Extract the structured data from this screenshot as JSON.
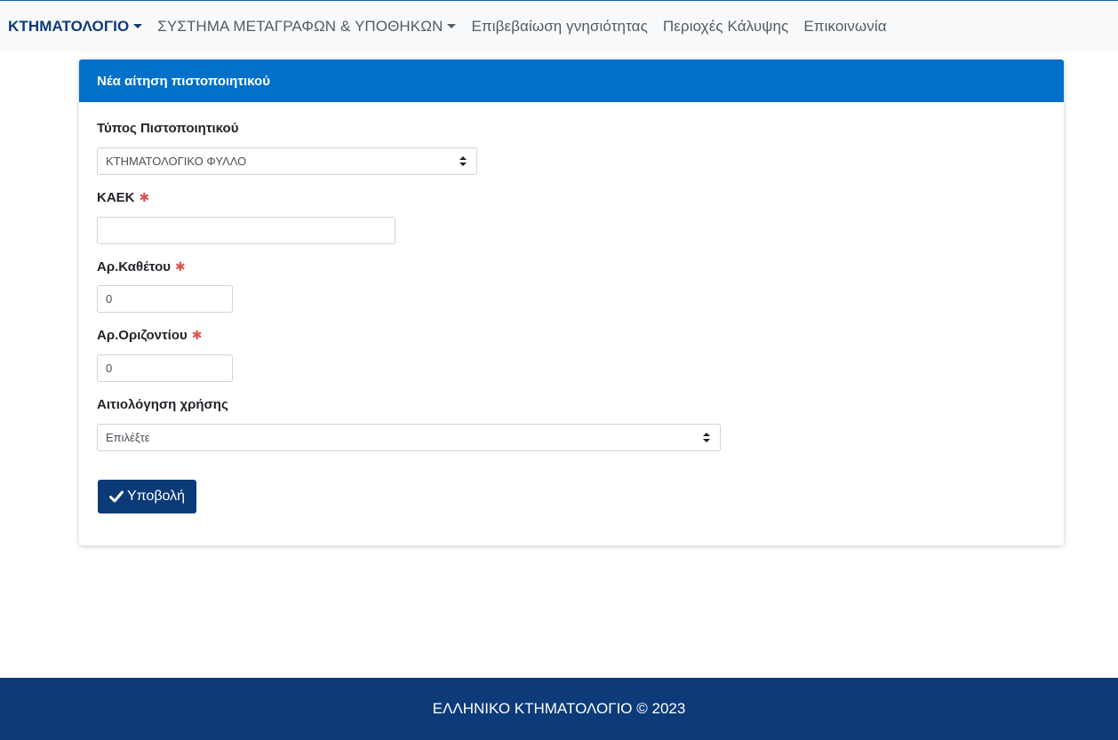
{
  "nav": {
    "items": [
      {
        "label": "ΚΤΗΜΑΤΟΛΟΓΙΟ",
        "dropdown": true
      },
      {
        "label": "ΣΥΣΤΗΜΑ ΜΕΤΑΓΡΑΦΩΝ & ΥΠΟΘΗΚΩΝ",
        "dropdown": true
      },
      {
        "label": "Επιβεβαίωση γνησιότητας",
        "dropdown": false
      },
      {
        "label": "Περιοχές Κάλυψης",
        "dropdown": false
      },
      {
        "label": "Επικοινωνία",
        "dropdown": false
      }
    ]
  },
  "form": {
    "title": "Νέα αίτηση πιστοποιητικού",
    "certificate_type": {
      "label": "Τύπος Πιστοποιητικού",
      "selected": "ΚΤΗΜΑΤΟΛΟΓΙΚΟ ΦΥΛΛΟ"
    },
    "kaek": {
      "label": "ΚΑΕΚ",
      "required_mark": "✱",
      "value": ""
    },
    "vertical_no": {
      "label": "Αρ.Καθέτου",
      "required_mark": "✱",
      "value": "0"
    },
    "horizontal_no": {
      "label": "Αρ.Οριζοντίου",
      "required_mark": "✱",
      "value": "0"
    },
    "usage_reason": {
      "label": "Αιτιολόγηση χρήσης",
      "selected": "Επιλέξτε"
    },
    "submit_label": "Υποβολή"
  },
  "footer": {
    "text": "ΕΛΛΗΝΙΚΟ ΚΤΗΜΑΤΟΛΟΓΙΟ © 2023"
  },
  "colors": {
    "header_blue": "#0070c9",
    "navy": "#0d3b7a",
    "required_red": "#d9534f"
  },
  "icons": {
    "submit": "check-icon",
    "dropdown": "caret-down-icon"
  }
}
